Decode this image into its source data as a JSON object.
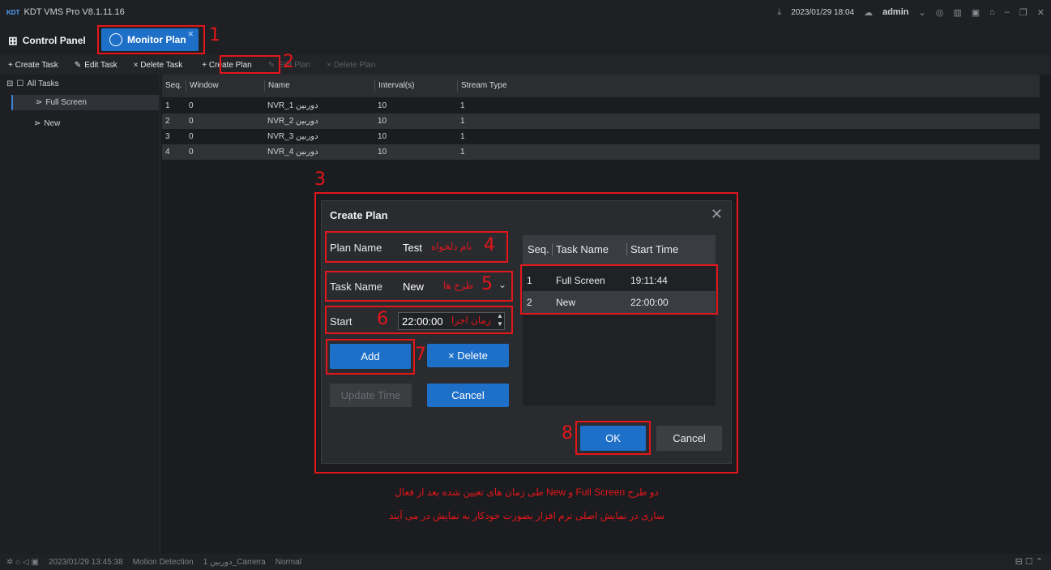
{
  "app": {
    "title": "KDT VMS Pro V8.1.11.16",
    "logo_text": "KDT"
  },
  "titlebar": {
    "datetime": "2023/01/29 18:04",
    "user": "admin"
  },
  "tabs": {
    "control_panel": "Control Panel",
    "monitor_plan": "Monitor Plan"
  },
  "toolbar": {
    "create_task": "+ Create Task",
    "edit_task": "Edit Task",
    "delete_task": "× Delete Task",
    "create_plan": "+ Create Plan",
    "edit_plan": "Edit Plan",
    "delete_plan": "× Delete Plan"
  },
  "tree": {
    "root": "All Tasks",
    "items": [
      "Full Screen",
      "New"
    ]
  },
  "table": {
    "headers": [
      "Seq.",
      "Window",
      "Name",
      "Interval(s)",
      "Stream Type"
    ],
    "rows": [
      [
        "1",
        "0",
        "NVR_دوربین 1",
        "10",
        "1"
      ],
      [
        "2",
        "0",
        "NVR_دوربین 2",
        "10",
        "1"
      ],
      [
        "3",
        "0",
        "NVR_دوربین 3",
        "10",
        "1"
      ],
      [
        "4",
        "0",
        "NVR_دوربین 4",
        "10",
        "1"
      ]
    ]
  },
  "dialog": {
    "title": "Create Plan",
    "plan_name_label": "Plan Name",
    "plan_name_value": "Test",
    "task_name_label": "Task Name",
    "task_name_value": "New",
    "start_label": "Start",
    "start_value": "22:00:00",
    "add": "Add",
    "delete": "× Delete",
    "update_time": "Update Time",
    "cancel_inner": "Cancel",
    "ok": "OK",
    "cancel": "Cancel",
    "plan_table": {
      "headers": [
        "Seq.",
        "Task Name",
        "Start Time"
      ],
      "rows": [
        [
          "1",
          "Full Screen",
          "19:11:44"
        ],
        [
          "2",
          "New",
          "22:00:00"
        ]
      ]
    }
  },
  "annotations": {
    "n1": "1",
    "n2": "2",
    "n3": "3",
    "n4": "4",
    "n5": "5",
    "n6": "6",
    "n7": "7",
    "n8": "8",
    "a4": "نام دلخواه",
    "a5": "طرح ها",
    "a6": "زمان اجرا",
    "note_line1": "دو طرح Full Screen و New طی زمان های تعیین شده بعد از فعال",
    "note_line2": "سازی در نمایش اصلی نرم افزار بصورت خودکار به نمایش در می آیند"
  },
  "statusbar": {
    "datetime": "2023/01/29 13:45:38",
    "event": "Motion Detection",
    "camera": "دوربین 1_Camera",
    "status": "Normal"
  }
}
